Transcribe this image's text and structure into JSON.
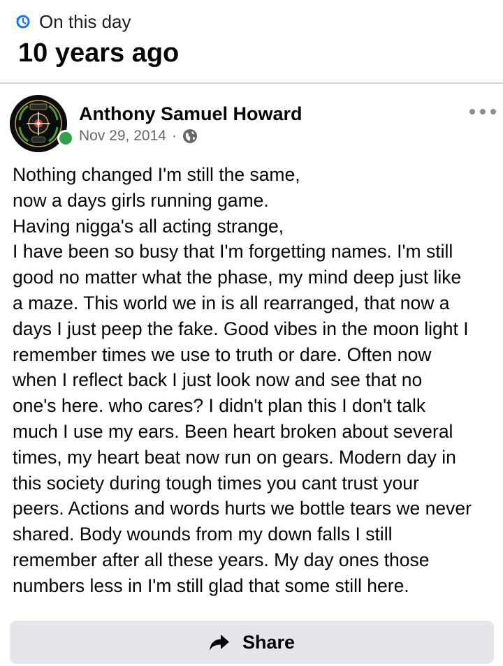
{
  "memory_header": {
    "label": "On this day",
    "years_ago": "10 years ago",
    "icon": "clock-history-icon",
    "accent_color": "#1877f2"
  },
  "post": {
    "author": "Anthony Samuel Howard",
    "date": "Nov 29, 2014",
    "separator": "·",
    "privacy_icon": "globe-icon",
    "online_status_color": "#31a24c",
    "more_icon": "more-dots-icon",
    "text_lines": [
      "Nothing changed I'm still the same,",
      "now a days girls running game.",
      "Having nigga's all acting strange,",
      "I have been so busy that I'm forgetting names. I'm still",
      "good no matter what the phase, my mind deep just like",
      "a maze. This world we in is all rearranged, that now a",
      "days I just peep the fake. Good vibes in the moon light I",
      "remember times we use to truth or dare. Often now",
      "when I reflect back I just look now and see that no",
      "one's here. who cares? I didn't plan this I don't talk",
      "much I use my ears. Been heart broken about several",
      "times, my heart beat now run on gears. Modern day in",
      "this society during tough times you cant trust your",
      "peers. Actions and words hurts we bottle tears we never",
      "shared. Body wounds from my down falls I still",
      "remember after all these years. My day ones those",
      "numbers less in I'm still glad that some still here."
    ]
  },
  "actions": {
    "share_label": "Share",
    "share_icon": "share-arrow-icon",
    "button_bg": "#e4e6eb"
  }
}
